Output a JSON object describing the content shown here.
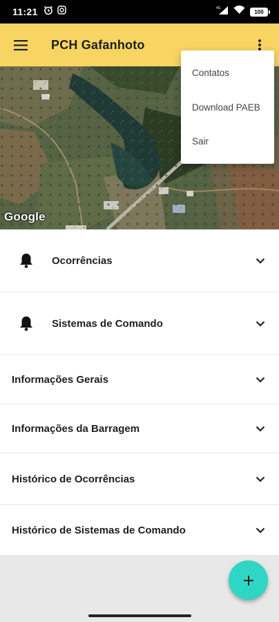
{
  "status_bar": {
    "time": "11:21",
    "battery": "100"
  },
  "app_bar": {
    "title": "PCH Gafanhoto"
  },
  "map": {
    "attribution": "Google"
  },
  "overflow_menu": {
    "items": [
      "Contatos",
      "Download PAEB",
      "Sair"
    ]
  },
  "sections": [
    {
      "label": "Ocorrências",
      "icon": "bell-icon"
    },
    {
      "label": "Sistemas de Comando",
      "icon": "bell-icon"
    },
    {
      "label": "Informações Gerais"
    },
    {
      "label": "Informações da Barragem"
    },
    {
      "label": "Histórico de Ocorrências"
    },
    {
      "label": "Histórico de Sistemas de Comando"
    }
  ],
  "fab": {
    "icon": "plus-icon"
  },
  "colors": {
    "app_bar": "#f8d463",
    "fab": "#2fd6c3"
  }
}
